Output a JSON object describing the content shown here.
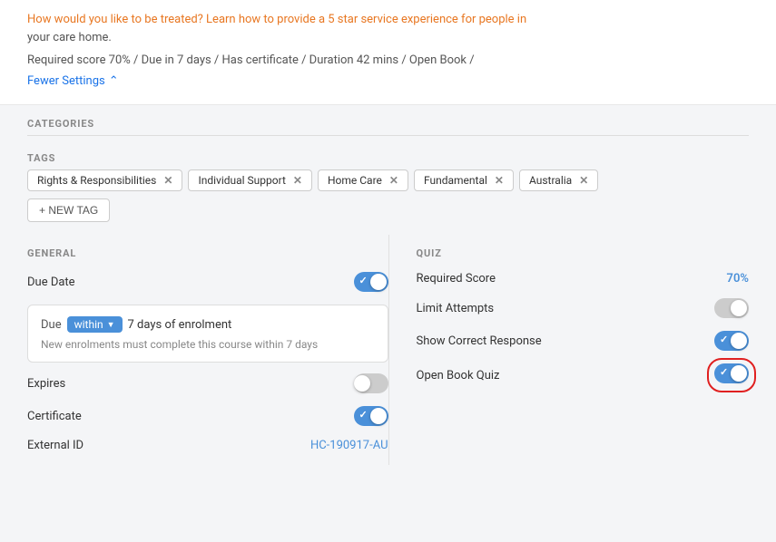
{
  "info": {
    "description_orange": "How would you like to be treated? Learn how to provide a 5 star service experience for people in",
    "description_dark": "your care home.",
    "meta": "Required score 70%  /  Due in 7 days  /  Has certificate  /  Duration 42 mins  /  Open Book  /",
    "fewer_settings": "Fewer Settings"
  },
  "categories": {
    "label": "CATEGORIES"
  },
  "tags": {
    "label": "TAGS",
    "items": [
      {
        "text": "Rights & Responsibilities"
      },
      {
        "text": "Individual Support"
      },
      {
        "text": "Home Care"
      },
      {
        "text": "Fundamental"
      },
      {
        "text": "Australia"
      }
    ],
    "new_tag_button": "+ NEW TAG"
  },
  "general": {
    "label": "GENERAL",
    "due_date": {
      "label": "Due Date",
      "enabled": true,
      "within_label": "within",
      "days": "7 days",
      "suffix": "of enrolment",
      "hint": "New enrolments must complete this course within 7 days"
    },
    "expires": {
      "label": "Expires",
      "enabled": false
    },
    "certificate": {
      "label": "Certificate",
      "enabled": true
    },
    "external_id": {
      "label": "External ID",
      "value": "HC-190917-AU"
    }
  },
  "quiz": {
    "label": "QUIZ",
    "required_score": {
      "label": "Required Score",
      "value": "70%"
    },
    "limit_attempts": {
      "label": "Limit Attempts",
      "enabled": false
    },
    "show_correct_response": {
      "label": "Show Correct Response",
      "enabled": true
    },
    "open_book_quiz": {
      "label": "Open Book Quiz",
      "enabled": true,
      "highlighted": true
    }
  }
}
